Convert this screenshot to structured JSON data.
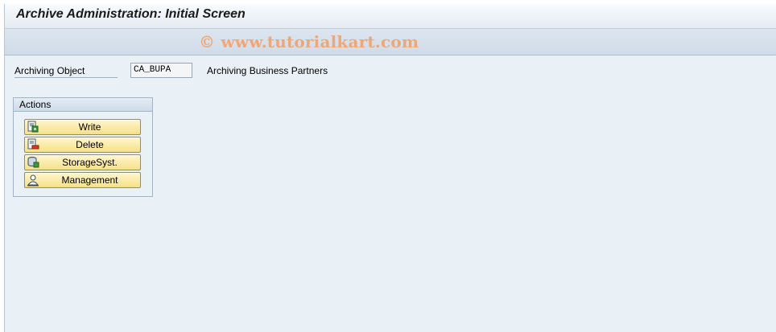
{
  "screen": {
    "title": "Archive Administration: Initial Screen",
    "watermark": "© www.tutorialkart.com"
  },
  "form": {
    "archiving_object_label": "Archiving Object",
    "archiving_object_value": "CA_BUPA",
    "archiving_object_description": "Archiving Business Partners"
  },
  "actions": {
    "title": "Actions",
    "buttons": [
      {
        "label": "Write",
        "icon": "write-icon"
      },
      {
        "label": "Delete",
        "icon": "delete-icon"
      },
      {
        "label": "StorageSyst.",
        "icon": "storage-system-icon"
      },
      {
        "label": "Management",
        "icon": "management-icon"
      }
    ]
  },
  "colors": {
    "button_bg": "#f6e187",
    "background": "#e9f0f6",
    "watermark": "#f0a777"
  }
}
